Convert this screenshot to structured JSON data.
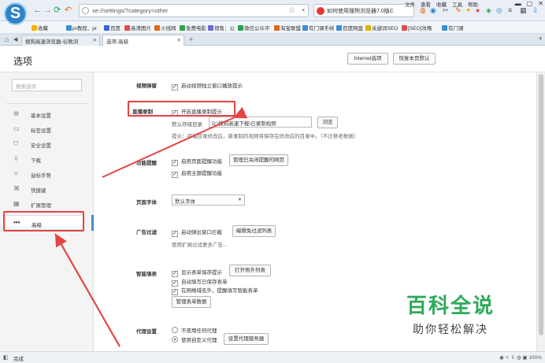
{
  "toolbar": {
    "logo_glyph": "S",
    "back_icon": "←",
    "forward_icon": "→",
    "reload_icon": "⟳",
    "undo_icon": "↶",
    "url": "se://settings/?category=other",
    "bookmark_star": "☆",
    "dropdown": "▾",
    "search_text": "如何使用搜狗浏览器7.0版C",
    "menu_items": [
      "文件",
      "查看",
      "收藏",
      "工具",
      "帮助"
    ],
    "window_buttons": [
      "▬",
      "▢",
      "✕"
    ]
  },
  "favorites": [
    {
      "label": "收藏",
      "color": "#f0b400"
    },
    {
      "label": "pr教程、pr",
      "color": "#3d8fd8"
    },
    {
      "label": "百度",
      "color": "#3d64d8"
    },
    {
      "label": "高清图片",
      "color": "#e34d4d"
    },
    {
      "label": "火线网",
      "color": "#e06a17"
    },
    {
      "label": "免费电影",
      "color": "#2ba34a"
    },
    {
      "label": "销售：公",
      "color": "#6a6ad8"
    },
    {
      "label": "微信公众平",
      "color": "#2ba34a"
    },
    {
      "label": "淘宝联盟",
      "color": "#e06a17"
    },
    {
      "label": "有门课手续",
      "color": "#3d8fd8"
    },
    {
      "label": "百度网盘",
      "color": "#3d8fd8"
    },
    {
      "label": "关键词SEO",
      "color": "#d9b400"
    },
    {
      "label": "[SEO]攻略",
      "color": "#e34d4d"
    },
    {
      "label": "有门课",
      "color": "#3d8fd8"
    }
  ],
  "tabs": [
    {
      "label": "搜狗高速浏览器-谷歌浏",
      "close": "✕"
    },
    {
      "label": "选项-高级",
      "close": "✕"
    }
  ],
  "tab_plus": "+",
  "header": {
    "title": "选项",
    "ie_options": "Internet选项",
    "restore_defaults": "恢复本页默认"
  },
  "sidebar": {
    "search_placeholder": "搜索选项",
    "items": [
      {
        "icon": "⚙",
        "label": "基本设置"
      },
      {
        "icon": "▭",
        "label": "标签设置"
      },
      {
        "icon": "⛉",
        "label": "安全设置"
      },
      {
        "icon": "⇩",
        "label": "下载"
      },
      {
        "icon": "✧",
        "label": "鼠标手势"
      },
      {
        "icon": "⌘",
        "label": "快捷键"
      },
      {
        "icon": "▦",
        "label": "扩展管理"
      },
      {
        "icon": "•••",
        "label": "高级"
      }
    ]
  },
  "settings": {
    "video_popup": {
      "label": "视频弹窗",
      "option": "启动视频独立窗口播放提示"
    },
    "live_record": {
      "label": "直播录制",
      "option": "开启直播录制提示",
      "dir_label": "默认存储目录",
      "dir_value": "D:\\搜狗高速下载\\已录制视频",
      "browse": "浏览",
      "hint": "提示：存储目录修改后，新录制的视频将保存在修改后的目录中。（不迁移老数据）"
    },
    "function_tips": {
      "label": "功能提醒",
      "opt1": "启用页面提醒功能",
      "manage_btn": "管理已关闭提醒的网页",
      "opt2": "启用主题提醒功能"
    },
    "page_font": {
      "label": "页面字体",
      "value": "默认字体"
    },
    "ad_filter": {
      "label": "广告过滤",
      "option": "启动弹出窗口拦截",
      "edit_btn": "编辑免过滤列表",
      "note": "使用扩展过滤更多广告..."
    },
    "smart_fill": {
      "label": "智能填表",
      "opt1": "显示表单保存提示",
      "open_btn": "打开例外列表",
      "opt2": "自动填写已保存表单",
      "opt3": "在网络域名外，提醒填写智能表单",
      "manage_btn": "管理表单数据"
    },
    "proxy": {
      "label": "代理设置",
      "opt1": "不使用任何代理",
      "opt2": "使用自定义代理",
      "settings_btn": "设置代理服务器"
    }
  },
  "status": {
    "text": "完成",
    "right": "100%"
  },
  "watermark": {
    "title": "百科全说",
    "subtitle": "助你轻松解决"
  },
  "colors": {
    "annotation_red": "#e54444",
    "accent_blue": "#3e8ed6",
    "watermark_green": "#2eaa58"
  }
}
